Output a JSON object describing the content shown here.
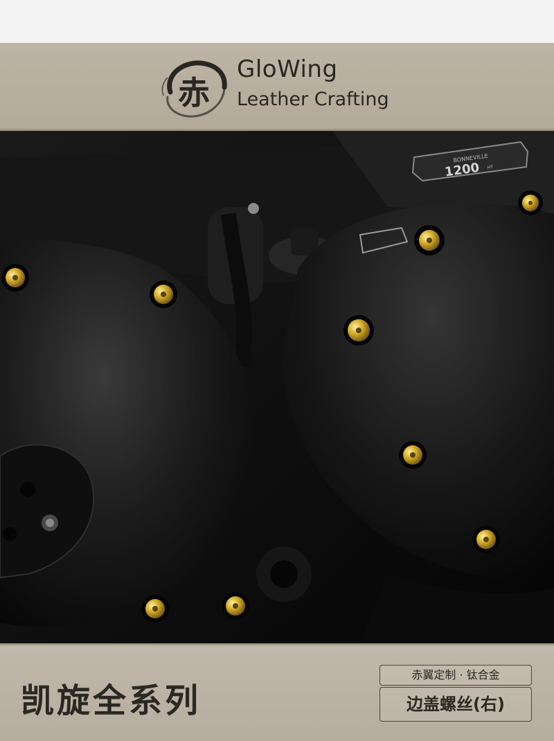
{
  "header": {
    "logo_glyph": "赤",
    "brand_name": "GloWing",
    "brand_sub": "Leather Crafting"
  },
  "photo": {
    "badge_top": "BONNEVILLE",
    "badge_main": "1200",
    "badge_suffix": "HT",
    "colors": {
      "engine_black": "#121212",
      "bolt_gold": "#c9a21c"
    }
  },
  "footer": {
    "series_title": "凯旋全系列",
    "tag_line": "赤翼定制 · 钛合金",
    "product_name": "边盖螺丝(右)"
  }
}
